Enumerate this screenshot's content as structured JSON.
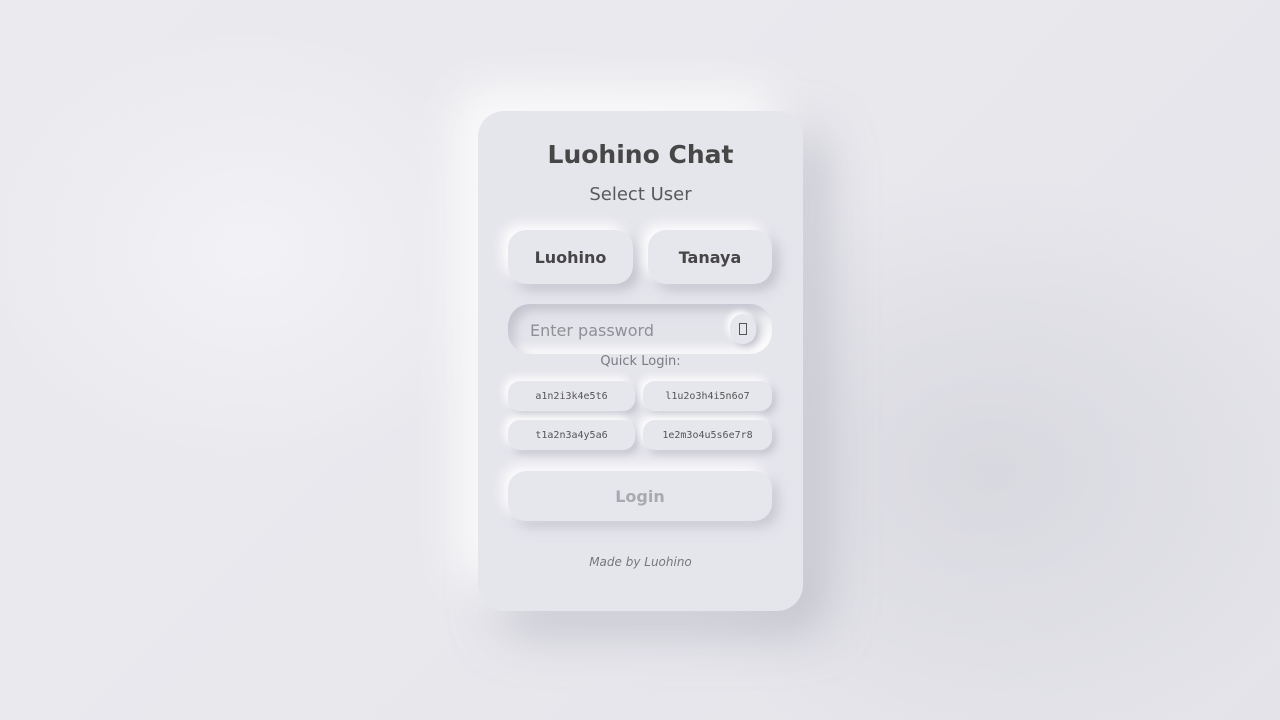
{
  "app": {
    "title": "Luohino Chat",
    "subtitle": "Select User"
  },
  "users": [
    {
      "label": "Luohino"
    },
    {
      "label": "Tanaya"
    }
  ],
  "password": {
    "placeholder": "Enter password",
    "value": "",
    "toggle_icon": "eye-icon",
    "toggle_glyph": "▯"
  },
  "quick_login": {
    "label": "Quick Login:",
    "codes": [
      "a1n2i3k4e5t6",
      "l1u2o3h4i5n6o7",
      "t1a2n3a4y5a6",
      "1e2m3o4u5s6e7r8"
    ]
  },
  "login_button": {
    "label": "Login",
    "state": "disabled"
  },
  "footer": {
    "text": "Made by Luohino"
  },
  "colors": {
    "background": "#e8e8ed",
    "card": "#e5e5ec",
    "text_primary": "#474747",
    "text_muted": "#7a7a80",
    "login_disabled_text": "#a9a9b0"
  }
}
